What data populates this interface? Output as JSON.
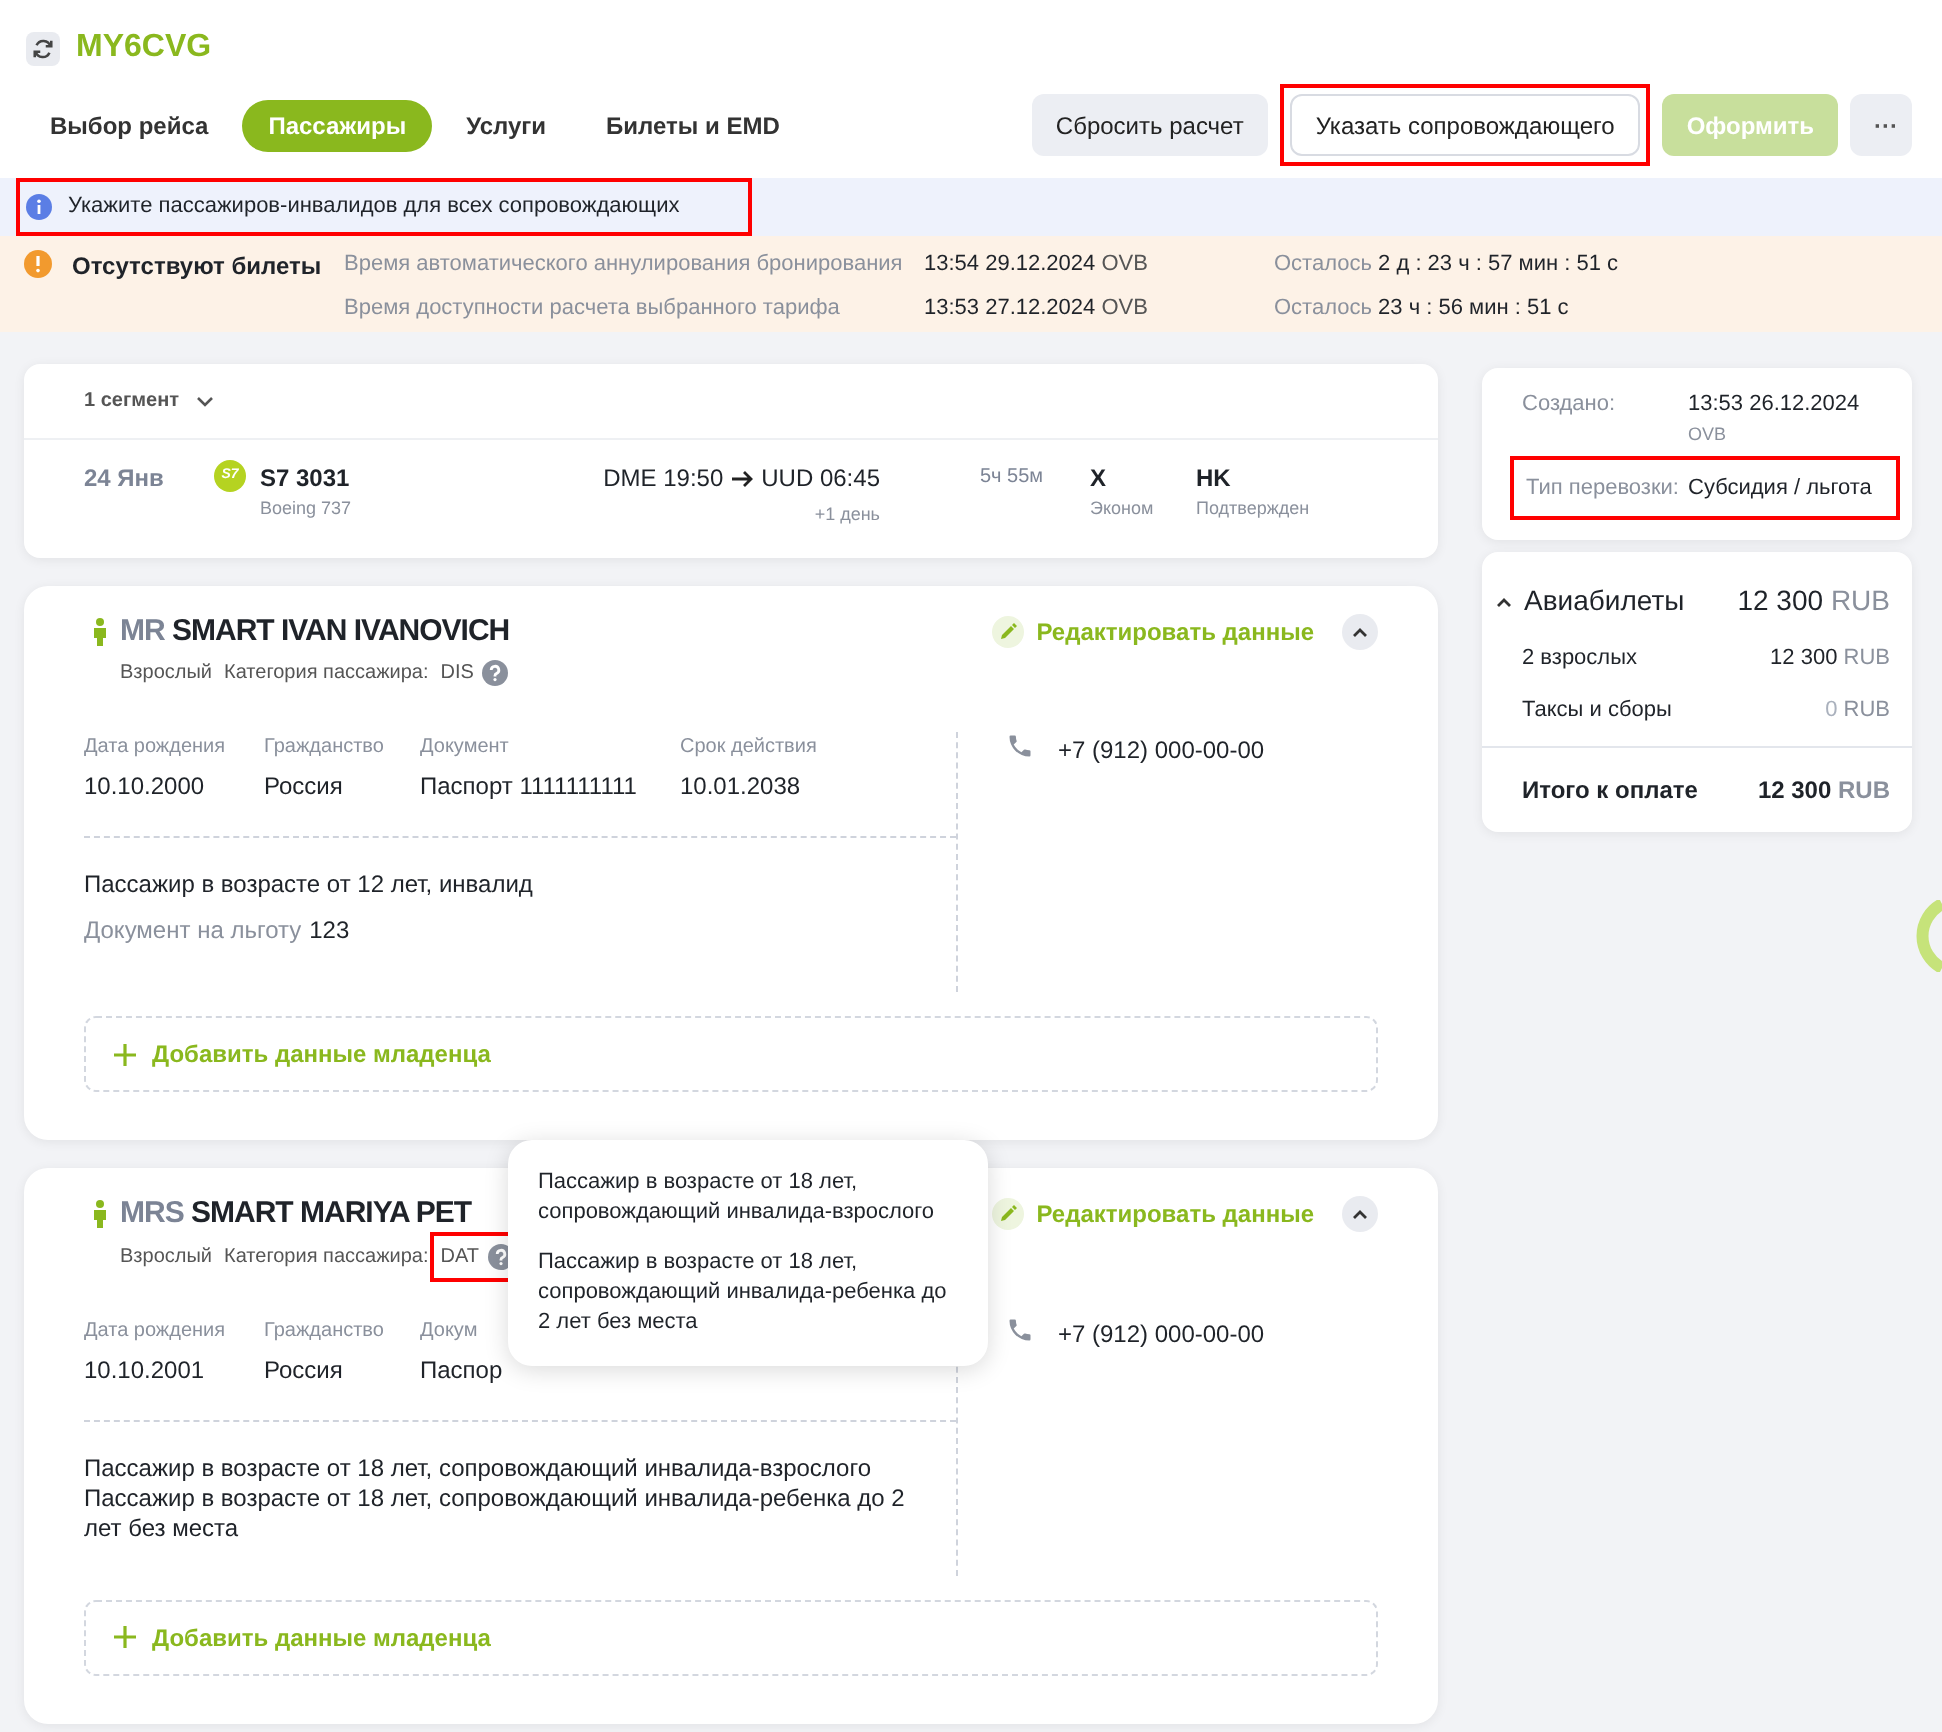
{
  "header": {
    "booking_code": "MY6CVG"
  },
  "tabs": [
    {
      "label": "Выбор рейса",
      "selected": false
    },
    {
      "label": "Пассажиры",
      "selected": true
    },
    {
      "label": "Услуги",
      "selected": false
    },
    {
      "label": "Билеты и EMD",
      "selected": false
    }
  ],
  "actions": [
    {
      "kind": "secondary",
      "label": "Сбросить расчет",
      "highlighted": false
    },
    {
      "kind": "outline",
      "label": "Указать сопровождающего",
      "highlighted": true
    },
    {
      "kind": "primary",
      "label": "Оформить",
      "highlighted": false,
      "disabled": true
    },
    {
      "kind": "more",
      "label": "···",
      "highlighted": false
    }
  ],
  "info_banner": {
    "text": "Укажите пассажиров-инвалидов для всех сопровождающих",
    "highlighted": true
  },
  "warning": {
    "title": "Отсутствуют билеты",
    "rows": [
      {
        "label": "Время автоматического аннулирования бронирования",
        "time": "13:54 29.12.2024",
        "station": "OVB",
        "remaining_label": "Осталось",
        "remaining": "2 д : 23 ч : 57 мин : 51 с"
      },
      {
        "label": "Время доступности расчета выбранного тарифа",
        "time": "13:53 27.12.2024",
        "station": "OVB",
        "remaining_label": "Осталось",
        "remaining": "23 ч : 56 мин : 51 с"
      }
    ]
  },
  "segments": {
    "toggle": "1 сегмент",
    "expanded": true,
    "flights": [
      {
        "date": "24 Янв",
        "airline_logo": "S7",
        "flight": "S7 3031",
        "aircraft": "Boeing 737",
        "departure": "DME 19:50",
        "arrival": "UUD 06:45",
        "day_shift": "+1 день",
        "duration": "5ч 55м",
        "class_code": "X",
        "class_name": "Эконом",
        "status_code": "HK",
        "status_name": "Подтвержден"
      }
    ]
  },
  "passengers": [
    {
      "title": "MR",
      "name": "SMART IVAN IVANOVICH",
      "type": "Взрослый",
      "category_label": "Категория пассажира:",
      "category": "DIS",
      "category_highlighted": false,
      "edit": "Редактировать данные",
      "expanded": true,
      "fields": [
        {
          "label": "Дата рождения",
          "value": "10.10.2000"
        },
        {
          "label": "Гражданство",
          "value": "Россия"
        },
        {
          "label": "Документ",
          "value": "Паспорт 1111111111"
        },
        {
          "label": "Срок действия",
          "value": "10.01.2038"
        }
      ],
      "notes": [
        {
          "text": "Пассажир в возрасте от 12 лет, инвалид"
        },
        {
          "label": "Документ на льготу",
          "text": "123"
        }
      ],
      "phone": "+7 (912) 000-00-00",
      "add_infant": "Добавить данные младенца"
    },
    {
      "title": "MRS",
      "name": "SMART MARIYA PET",
      "type": "Взрослый",
      "category_label": "Категория пассажира:",
      "category": "DAT",
      "category_highlighted": true,
      "edit": "Редактировать данные",
      "expanded": true,
      "fields": [
        {
          "label": "Дата рождения",
          "value": "10.10.2001"
        },
        {
          "label": "Гражданство",
          "value": "Россия"
        },
        {
          "label": "Докум",
          "value": "Паспор"
        }
      ],
      "notes": [
        {
          "text": "Пассажир в возрасте от 18 лет, сопровождающий инвалида-взрослого"
        },
        {
          "text": "Пассажир в возрасте от 18 лет, сопровождающий инвалида-ребенка до 2 лет без места"
        }
      ],
      "phone": "+7 (912) 000-00-00",
      "add_infant": "Добавить данные младенца",
      "tooltip": [
        "Пассажир в возрасте от 18 лет, сопровождающий инвалида-взрослого",
        "Пассажир в возрасте от 18 лет, сопровождающий инвалида-ребенка до 2 лет без места"
      ]
    }
  ],
  "summary": {
    "created_label": "Создано:",
    "created": "13:53 26.12.2024",
    "created_station": "OVB",
    "transport_label": "Тип перевозки:",
    "transport": "Субсидия / льгота",
    "transport_highlighted": true
  },
  "prices": {
    "title": "Авиабилеты",
    "expanded": true,
    "amount": "12 300",
    "currency": "RUB",
    "lines": [
      {
        "label": "2 взрослых",
        "amount": "12 300",
        "currency": "RUB",
        "zero": false
      },
      {
        "label": "Таксы и сборы",
        "amount": "0",
        "currency": "RUB",
        "zero": true
      }
    ],
    "total_label": "Итого к оплате",
    "total": "12 300",
    "total_currency": "RUB"
  }
}
